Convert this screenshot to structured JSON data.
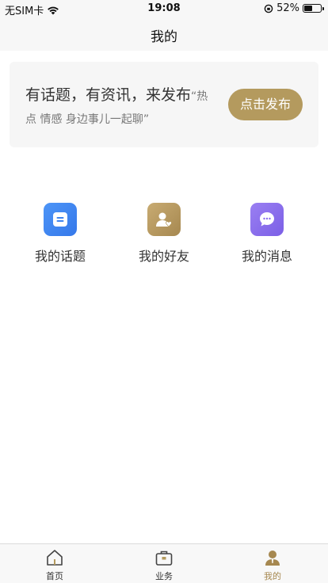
{
  "status_bar": {
    "carrier": "无SIM卡",
    "time": "19:08",
    "battery_percent": "52%",
    "battery_level": 0.52
  },
  "nav": {
    "title": "我的"
  },
  "banner": {
    "headline": "有话题，有资讯，来发布",
    "subline_part1": "“热",
    "subline_part2": "点 情感 身边事儿一起聊”",
    "button_label": "点击发布",
    "button_color": "#b49a5e"
  },
  "features": [
    {
      "label": "我的话题",
      "icon": "topic-icon",
      "color": "#3d83ef"
    },
    {
      "label": "我的好友",
      "icon": "friend-icon",
      "color": "#b49a5e"
    },
    {
      "label": "我的消息",
      "icon": "message-icon",
      "color": "#8b6cef"
    }
  ],
  "tab_bar": {
    "items": [
      {
        "label": "首页",
        "icon": "home-icon",
        "active": false
      },
      {
        "label": "业务",
        "icon": "briefcase-icon",
        "active": false
      },
      {
        "label": "我的",
        "icon": "profile-icon",
        "active": true
      }
    ],
    "active_color": "#a68850"
  }
}
